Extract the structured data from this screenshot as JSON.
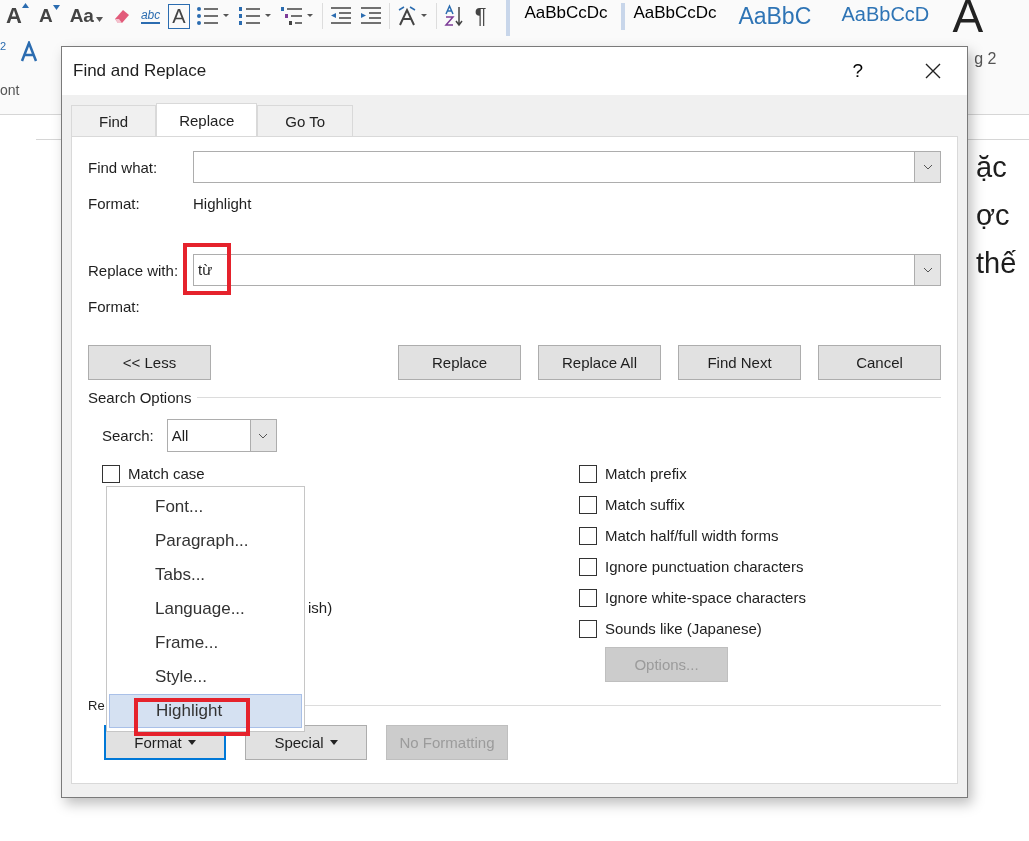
{
  "ribbon": {
    "font_buttons": [
      "A",
      "A",
      "Aa"
    ],
    "text_effect": "abc",
    "boxed": "A",
    "pilcrow": "¶",
    "superscript": "2",
    "styles": [
      "AaBbCcDc",
      "AaBbCcDc",
      "AaBbC",
      "AaBbCcD"
    ],
    "large_letter": "A",
    "group_fragments": [
      "ont",
      "g 2"
    ]
  },
  "document": {
    "lines": [
      "ặc",
      "ợc",
      "thế"
    ]
  },
  "dialog": {
    "title": "Find and Replace",
    "help": "?",
    "tabs": [
      {
        "label": "Find",
        "selected": false
      },
      {
        "label": "Replace",
        "selected": true
      },
      {
        "label": "Go To",
        "selected": false
      }
    ],
    "find_what": {
      "label": "Find what:",
      "format_label": "Format:",
      "format_value": "Highlight"
    },
    "replace_with": {
      "label": "Replace with:",
      "value": "từ",
      "format_label": "Format:"
    },
    "less_button": "<< Less",
    "actions": [
      "Replace",
      "Replace All",
      "Find Next",
      "Cancel"
    ],
    "search_options": {
      "heading": "Search Options",
      "search_label": "Search:",
      "search_value": "All",
      "left_options": [
        {
          "label": "Match case",
          "checked": false
        }
      ],
      "covered_fragment": "ish)",
      "right_options": [
        {
          "label": "Match prefix",
          "checked": false
        },
        {
          "label": "Match suffix",
          "checked": false
        },
        {
          "label": "Match half/full width forms",
          "checked": false
        },
        {
          "label": "Ignore punctuation characters",
          "checked": false
        },
        {
          "label": "Ignore white-space characters",
          "checked": false
        },
        {
          "label": "Sounds like (Japanese)",
          "checked": false
        }
      ],
      "options_button": {
        "label": "Options...",
        "disabled": true
      }
    },
    "replace_section": {
      "heading_fragment": "Re",
      "buttons": [
        {
          "label": "Format",
          "dropdown": true,
          "disabled": false,
          "focused": true
        },
        {
          "label": "Special",
          "dropdown": true,
          "disabled": false,
          "focused": false
        },
        {
          "label": "No Formatting",
          "dropdown": false,
          "disabled": true,
          "focused": false
        }
      ]
    },
    "format_menu": {
      "items": [
        {
          "label": "Font...",
          "selected": false
        },
        {
          "label": "Paragraph...",
          "selected": false
        },
        {
          "label": "Tabs...",
          "selected": false
        },
        {
          "label": "Language...",
          "selected": false
        },
        {
          "label": "Frame...",
          "selected": false
        },
        {
          "label": "Style...",
          "selected": false
        },
        {
          "label": "Highlight",
          "selected": true
        }
      ]
    }
  }
}
